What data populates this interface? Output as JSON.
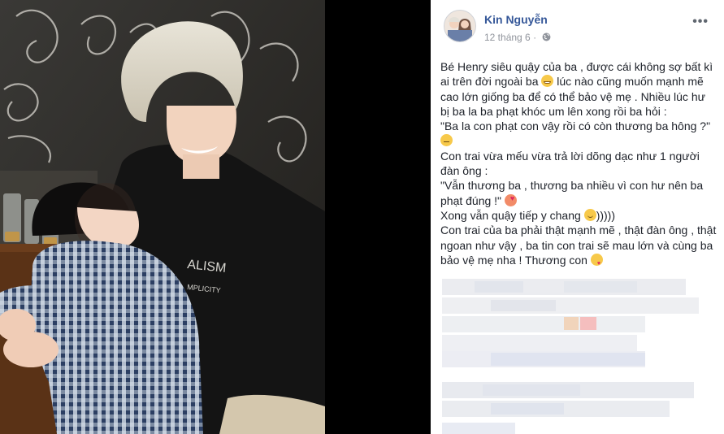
{
  "post": {
    "author": "Kin Nguyễn",
    "date": "12 tháng 6",
    "privacy_icon": "globe-icon",
    "more_icon": "more-options-icon",
    "paragraphs": [
      {
        "text": "Bé Henry siêu quậy của ba , được cái không sợ bất kì ai trên đời ngoài ba ",
        "emoji": "grin",
        "after": " lúc nào cũng muốn mạnh mẽ cao lớn giống ba để có thể bảo vệ mẹ . Nhiều lúc hư bị ba la ba phạt khóc um lên xong rồi ba hỏi :"
      },
      {
        "text": "\"Ba la con phạt con vậy rồi có còn thương ba hông ?\" ",
        "emoji": "neutral",
        "after": ""
      },
      {
        "text": "Con trai vừa mếu vừa trả lời dõng dạc như 1 người đàn ông :",
        "emoji": "",
        "after": ""
      },
      {
        "text": "\"Vẫn thương ba , thương ba nhiều vì con hư nên ba phạt đúng !\" ",
        "emoji": "love",
        "after": ""
      },
      {
        "text": "Xong vẫn quậy tiếp y chang ",
        "emoji": "smile",
        "after": ")))))"
      },
      {
        "text": "Con trai của ba phải thật mạnh mẽ , thật đàn ông , thật ngoan như vậy , ba tin con trai sẽ mau lớn và cùng ba bảo vệ mẹ nha ! Thương con ",
        "emoji": "kiss",
        "after": ""
      }
    ]
  },
  "colors": {
    "author": "#365899",
    "meta": "#90949c",
    "text": "#1d2129",
    "background_left": "#000000"
  }
}
